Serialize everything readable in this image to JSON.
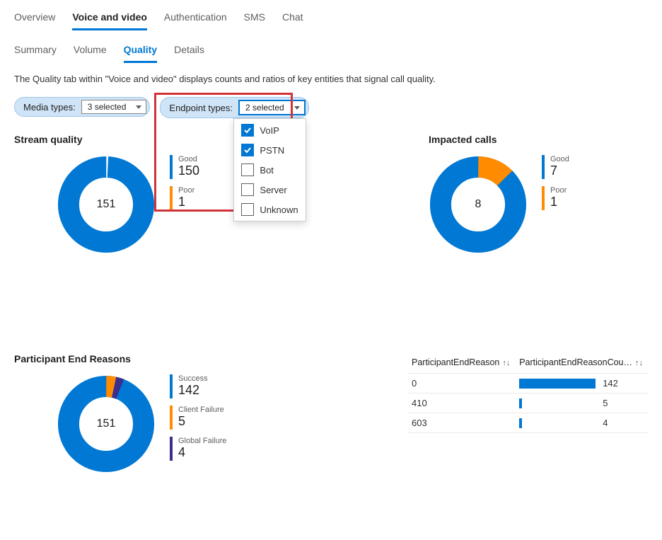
{
  "top_tabs": {
    "overview": "Overview",
    "voice_video": "Voice and video",
    "authentication": "Authentication",
    "sms": "SMS",
    "chat": "Chat",
    "active": "voice_video"
  },
  "sub_tabs": {
    "summary": "Summary",
    "volume": "Volume",
    "quality": "Quality",
    "details": "Details",
    "active": "quality"
  },
  "description": "The Quality tab within \"Voice and video\" displays counts and ratios of key entities that signal call quality.",
  "filters": {
    "media_types": {
      "label": "Media types:",
      "selected_text": "3 selected"
    },
    "endpoint_types": {
      "label": "Endpoint types:",
      "selected_text": "2 selected",
      "options": [
        {
          "label": "VoIP",
          "checked": true
        },
        {
          "label": "PSTN",
          "checked": true
        },
        {
          "label": "Bot",
          "checked": false
        },
        {
          "label": "Server",
          "checked": false
        },
        {
          "label": "Unknown",
          "checked": false
        }
      ]
    }
  },
  "panels": {
    "stream_quality": {
      "title": "Stream quality",
      "total": "151",
      "legend": [
        {
          "label": "Good",
          "value": "150",
          "color": "#0078d4"
        },
        {
          "label": "Poor",
          "value": "1",
          "color": "#ff8c00"
        }
      ]
    },
    "impacted_calls": {
      "title": "Impacted calls",
      "total": "8",
      "legend": [
        {
          "label": "Good",
          "value": "7",
          "color": "#0078d4"
        },
        {
          "label": "Poor",
          "value": "1",
          "color": "#ff8c00"
        }
      ]
    },
    "end_reasons": {
      "title": "Participant End Reasons",
      "total": "151",
      "legend": [
        {
          "label": "Success",
          "value": "142",
          "color": "#0078d4"
        },
        {
          "label": "Client Failure",
          "value": "5",
          "color": "#ff8c00"
        },
        {
          "label": "Global Failure",
          "value": "4",
          "color": "#3b2e8c"
        }
      ]
    },
    "table": {
      "col1": "ParticipantEndReason",
      "col2": "ParticipantEndReasonCou…",
      "rows": [
        {
          "reason": "0",
          "count": "142",
          "width": 108
        },
        {
          "reason": "410",
          "count": "5",
          "width": 4
        },
        {
          "reason": "603",
          "count": "4",
          "width": 4
        }
      ]
    }
  },
  "chart_data": [
    {
      "type": "pie",
      "title": "Stream quality",
      "categories": [
        "Good",
        "Poor"
      ],
      "values": [
        150,
        1
      ],
      "total": 151
    },
    {
      "type": "pie",
      "title": "Impacted calls",
      "categories": [
        "Good",
        "Poor"
      ],
      "values": [
        7,
        1
      ],
      "total": 8
    },
    {
      "type": "pie",
      "title": "Participant End Reasons",
      "categories": [
        "Success",
        "Client Failure",
        "Global Failure"
      ],
      "values": [
        142,
        5,
        4
      ],
      "total": 151
    },
    {
      "type": "bar",
      "title": "ParticipantEndReasonCount",
      "categories": [
        "0",
        "410",
        "603"
      ],
      "values": [
        142,
        5,
        4
      ]
    }
  ]
}
